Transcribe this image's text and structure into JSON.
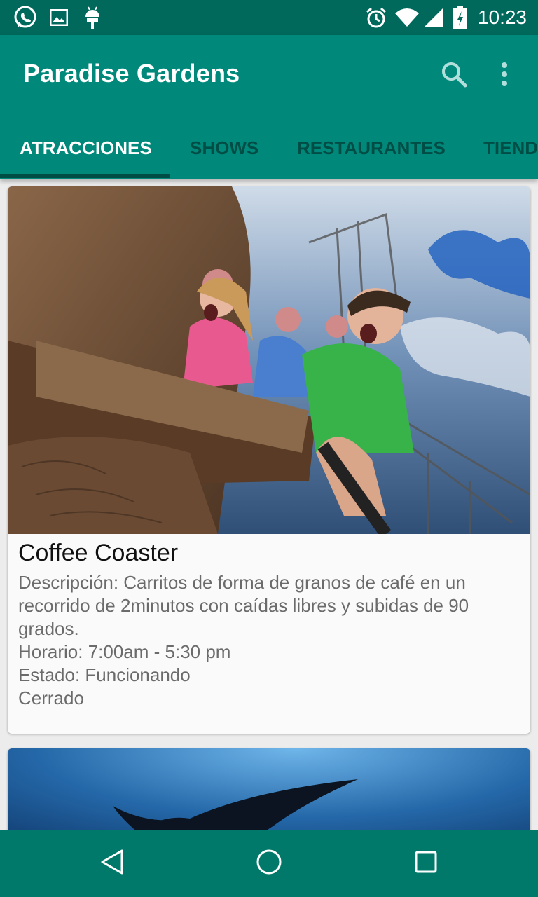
{
  "status_bar": {
    "time": "10:23",
    "icons": [
      "whatsapp-icon",
      "image-icon",
      "android-icon",
      "alarm-icon",
      "wifi-icon",
      "signal-icon",
      "battery-icon"
    ]
  },
  "app_bar": {
    "title": "Paradise Gardens",
    "actions": [
      "search-icon",
      "more-vert-icon"
    ]
  },
  "tabs": [
    {
      "label": "ATRACCIONES",
      "active": true
    },
    {
      "label": "SHOWS",
      "active": false
    },
    {
      "label": "RESTAURANTES",
      "active": false
    },
    {
      "label": "TIENDAS",
      "active": false
    }
  ],
  "cards": [
    {
      "image": "roller-coaster-riders-photo",
      "title": "Coffee Coaster",
      "description": "Descripción: Carritos de forma de granos de café en un recorrido de 2minutos con caídas libres y subidas de 90 grados.",
      "schedule": "Horario: 7:00am - 5:30 pm",
      "status": "Estado: Funcionando",
      "state": "Cerrado"
    },
    {
      "image": "manta-ray-underwater-photo"
    }
  ],
  "nav_bar": [
    "back-icon",
    "home-icon",
    "recents-icon"
  ],
  "colors": {
    "primary": "#00897b",
    "primary_dark": "#00695c",
    "tab_inactive": "#004d45",
    "background": "#ececec"
  }
}
